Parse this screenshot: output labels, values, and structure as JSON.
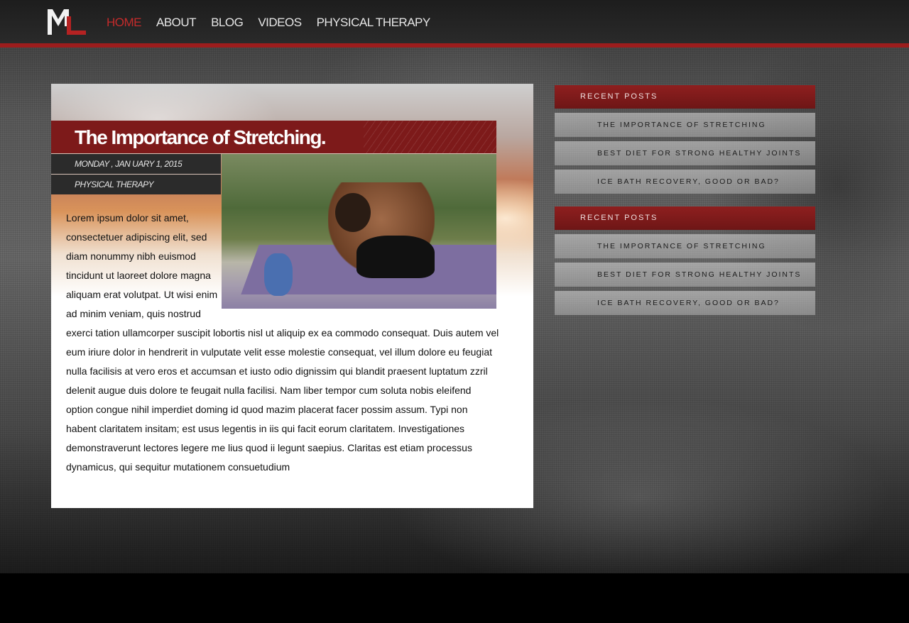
{
  "nav": {
    "logo_text": "ML",
    "items": [
      {
        "label": "HOME",
        "active": true
      },
      {
        "label": "ABOUT"
      },
      {
        "label": "BLOG"
      },
      {
        "label": "VIDEOS"
      },
      {
        "label": "PHYSICAL THERAPY"
      }
    ]
  },
  "article": {
    "title": "The Importance of Stretching.",
    "date": "MONDAY , JAN UARY 1, 2015",
    "category": "PHYSICAL THERAPY",
    "body": "Lorem ipsum dolor sit amet, consectetuer adipiscing elit, sed diam nonummy nibh euismod tincidunt ut laoreet dolore magna aliquam erat volutpat. Ut wisi enim ad minim veniam, quis nostrud exerci tation ullamcorper suscipit lobortis nisl ut aliquip ex ea commodo consequat. Duis autem vel eum iriure dolor in hendrerit in vulputate velit esse molestie consequat, vel illum dolore eu feugiat nulla facilisis at vero eros et accumsan et iusto odio dignissim qui blandit praesent luptatum zzril delenit augue duis dolore te feugait nulla facilisi. Nam liber tempor cum soluta nobis eleifend option congue nihil imperdiet doming id quod mazim placerat facer possim assum. Typi non habent claritatem insitam; est usus legentis in iis qui facit eorum claritatem. Investigationes demonstraverunt lectores legere me lius quod ii legunt saepius. Claritas est etiam processus dynamicus, qui sequitur mutationem consuetudium"
  },
  "sidebar": {
    "groups": [
      {
        "heading": "RECENT POSTS",
        "items": [
          "THE IMPORTANCE OF STRETCHING",
          "BEST DIET FOR STRONG HEALTHY JOINTS",
          "ICE BATH RECOVERY, GOOD OR BAD?"
        ]
      },
      {
        "heading": "RECENT POSTS",
        "items": [
          "THE IMPORTANCE OF STRETCHING",
          "BEST DIET FOR STRONG HEALTHY JOINTS",
          "ICE BATH RECOVERY, GOOD OR BAD?"
        ]
      }
    ]
  },
  "colors": {
    "accent_red": "#9c1d1d",
    "nav_active": "#c42b2b",
    "title_bar": "#7d1a1a"
  }
}
